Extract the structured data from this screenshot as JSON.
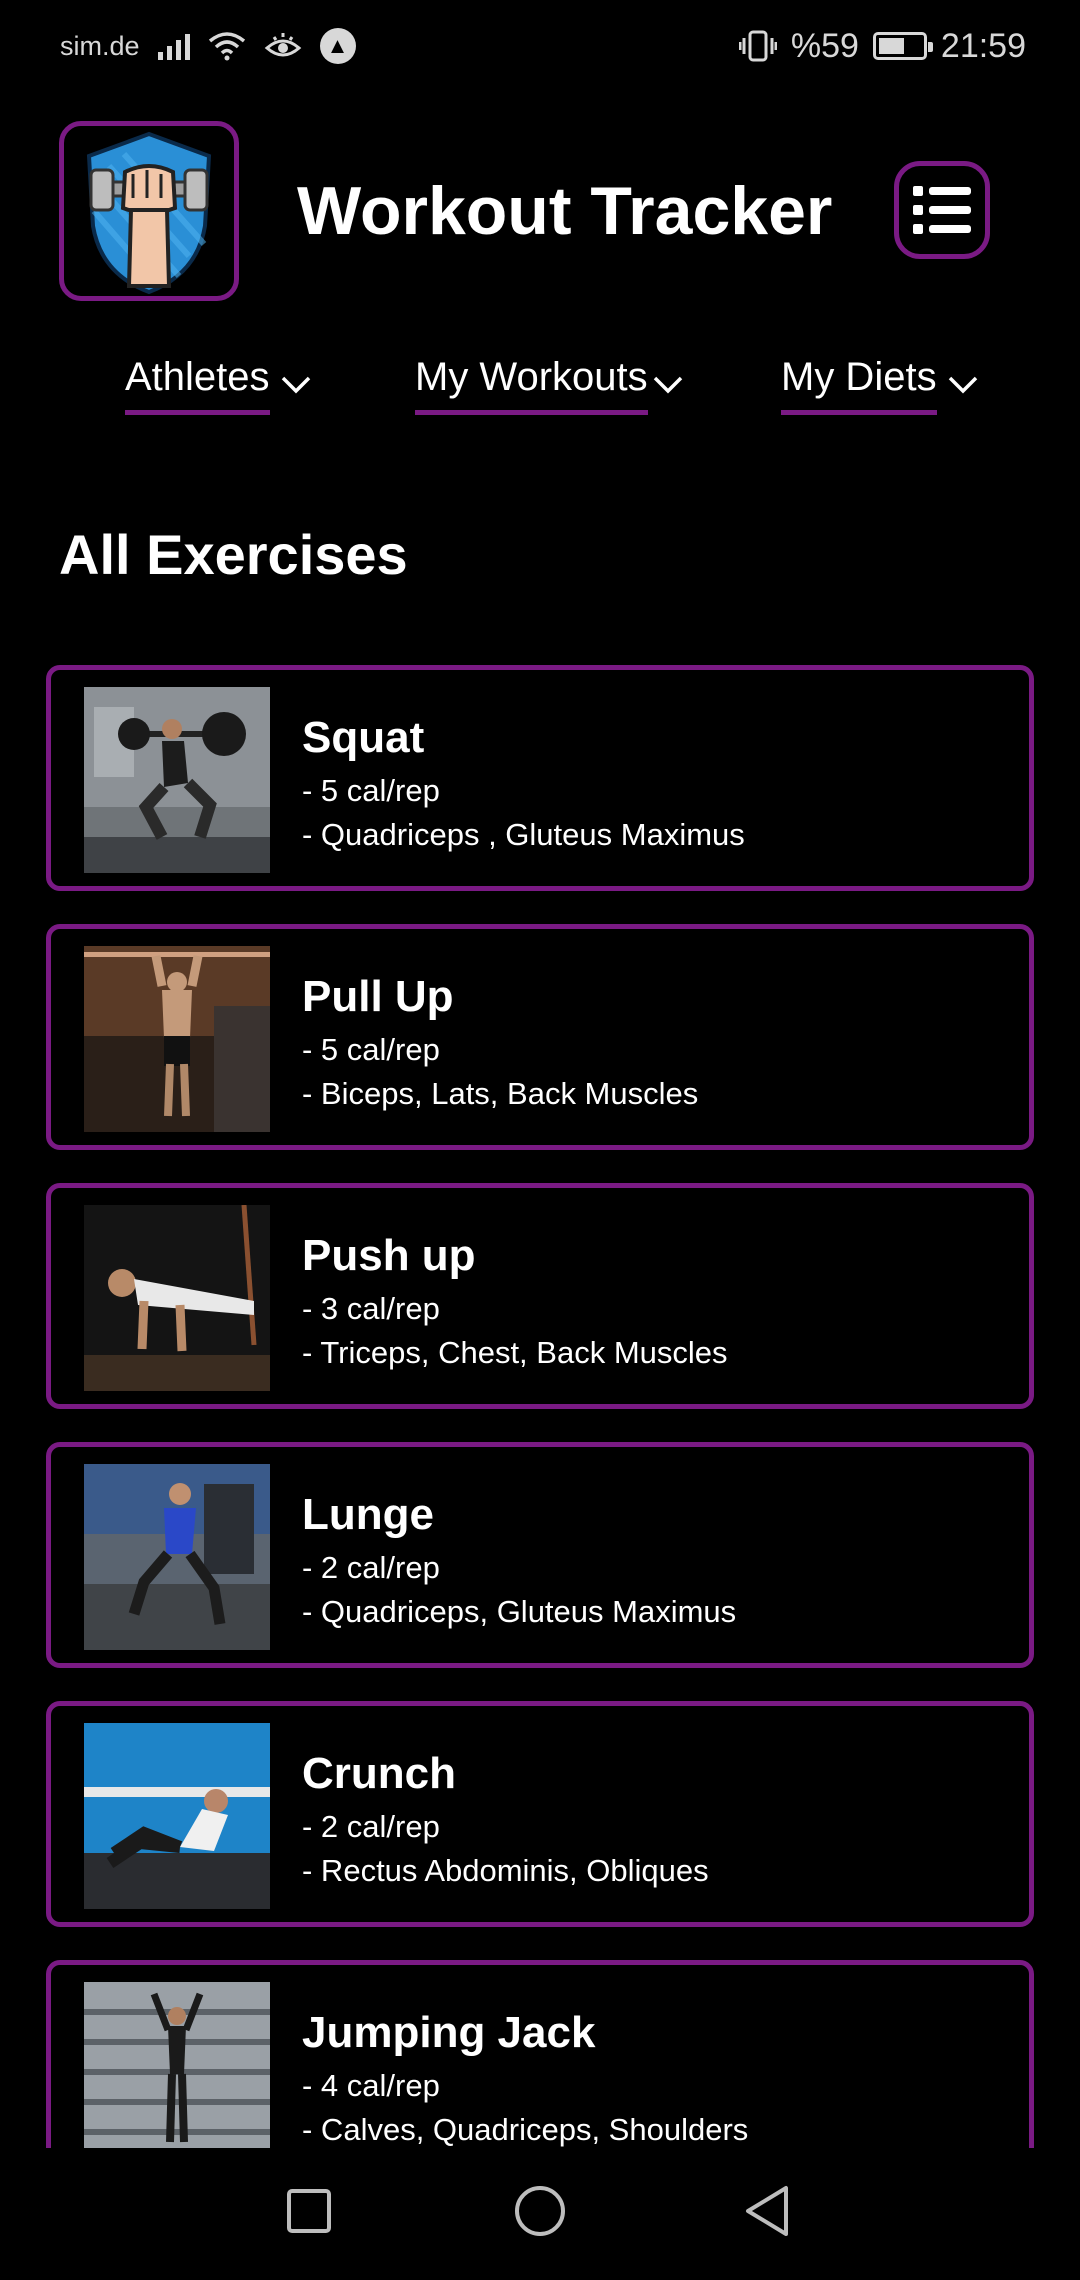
{
  "status_bar": {
    "carrier": "sim.de",
    "battery_text": "%59",
    "battery_level": 0.59,
    "time": "21:59",
    "icons": [
      "signal-icon",
      "wifi-icon",
      "eye-icon",
      "a-circle-icon",
      "vibrate-icon",
      "battery-icon"
    ]
  },
  "header": {
    "title": "Workout Tracker",
    "logo_icon": "fist-dumbbell-shield-icon",
    "menu_icon": "list-menu-icon"
  },
  "nav": {
    "items": [
      {
        "label": "Athletes"
      },
      {
        "label": "My Workouts"
      },
      {
        "label": "My Diets"
      }
    ]
  },
  "section_title": "All Exercises",
  "exercises": [
    {
      "name": "Squat",
      "calories": "- 5 cal/rep",
      "muscles": "- Quadriceps , Gluteus Maximus"
    },
    {
      "name": "Pull Up",
      "calories": "- 5 cal/rep",
      "muscles": "- Biceps, Lats, Back Muscles"
    },
    {
      "name": "Push up",
      "calories": "- 3 cal/rep",
      "muscles": "- Triceps, Chest, Back Muscles"
    },
    {
      "name": "Lunge",
      "calories": "- 2 cal/rep",
      "muscles": "- Quadriceps, Gluteus Maximus"
    },
    {
      "name": "Crunch",
      "calories": "- 2 cal/rep",
      "muscles": "- Rectus Abdominis, Obliques"
    },
    {
      "name": "Jumping Jack",
      "calories": "- 4 cal/rep",
      "muscles": "- Calves, Quadriceps, Shoulders"
    }
  ],
  "system_nav": {
    "icons": [
      "recents-square-icon",
      "home-circle-icon",
      "back-triangle-icon"
    ]
  },
  "colors": {
    "accent": "#7a1a84",
    "background": "#000000",
    "text": "#ffffff"
  }
}
